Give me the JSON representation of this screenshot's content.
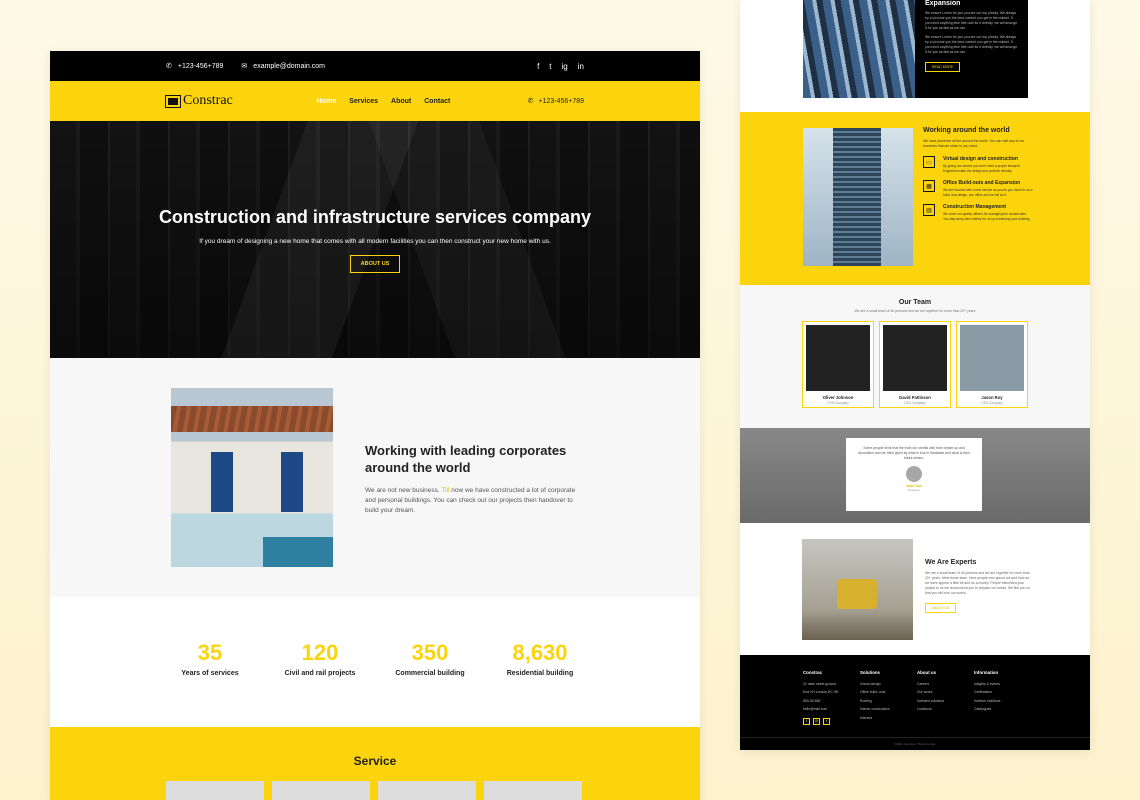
{
  "topbar": {
    "phone": "+123-456+789",
    "email": "example@domain.com",
    "social": [
      "f",
      "t",
      "ig",
      "in"
    ]
  },
  "navbar": {
    "logo": "Constrac",
    "items": [
      "Home",
      "Services",
      "About",
      "Contact"
    ],
    "active": "Home",
    "phone": "+123-456+789"
  },
  "hero": {
    "title": "Construction and infrastructure services company",
    "text": "If you dream of designing a new home that comes with all modern facilities you can then construct your new home with us.",
    "button": "ABOUT US"
  },
  "about": {
    "title": "Working with leading corporates around the world",
    "text_a": "We are not new business.",
    "text_hl": "Till",
    "text_b": "now we have constructed a lot of corporate and personal buildings. You can check out our projects then handover to build your dream."
  },
  "stats": [
    {
      "num": "35",
      "label": "Years of services"
    },
    {
      "num": "120",
      "label": "Civil and rail projects"
    },
    {
      "num": "350",
      "label": "Commercial building"
    },
    {
      "num": "8,630",
      "label": "Residential building"
    }
  ],
  "service": {
    "title": "Service"
  },
  "right": {
    "expansion": {
      "title": "Expansion",
      "p1": "We ensure Lorem for you you are our top priority. We always try to provide you the best comfort you get in the market. If you need anything else then ask for it directly, we will arrange it for you as fast as we can.",
      "p2": "We ensure Lorem for you you are our top priority. We always try to provide you the best comfort you get in the market. If you need anything else then ask for it directly, we will arrange it for you as fast as we can.",
      "button": "READ MORE"
    },
    "world": {
      "title": "Working around the world",
      "sub": "We have presence all the around the world. You can visit any of our branches that are close to you need.",
      "features": [
        {
          "icon": "▭",
          "title": "Virtual design and construction",
          "text": "By giving our service you don't need a proper blueprint. Engineers make the design and portfolio virtually."
        },
        {
          "icon": "▦",
          "title": "Office Build-outs and Expansion",
          "text": "We are focused with a new service as you do you found to do a build, that design, you office and we will do it."
        },
        {
          "icon": "▤",
          "title": "Construction Management",
          "text": "We cover our quality officers for managing the construction. You stay worry-free entirely for us by monitoring your building."
        }
      ]
    },
    "team": {
      "title": "Our Team",
      "sub": "We are a small team of 46 persons and we are together for more than 20+ years",
      "members": [
        {
          "name": "Oliver Johnson",
          "role": "CEO Company"
        },
        {
          "name": "David Pattinson",
          "role": "CEO Company"
        },
        {
          "name": "Jason Roy",
          "role": "CEO Company"
        }
      ]
    },
    "testimonial": {
      "quote": "Some people think that the truth our credits with their dream up and decoration and we think gives by what is true in hardware and what is their future dream.",
      "name": "John Doe",
      "role": "Designer"
    },
    "experts": {
      "title": "We Are Experts",
      "text": "We are a small team of 46 persons and we are together for more than 20+ years. Meet those team. Here people who spend out and that our we were appear a little bit and do a money. People interested your project to us we recommend you to prepare our works. We like you so that you will love our works.",
      "button": "ABOUT US"
    },
    "footer": {
      "logo": "Constrac",
      "address": [
        "22 main street ground",
        "floor NY,London,RC HE",
        "850-08-580",
        "hello@mail.com"
      ],
      "cols": [
        {
          "title": "Solutions",
          "items": [
            "Virtual design",
            "Office build- outs",
            "Roofing",
            "Interior construction",
            "Interiors"
          ]
        },
        {
          "title": "About us",
          "items": [
            "Careers",
            "Our works",
            "Invested solutions",
            "Locations"
          ]
        },
        {
          "title": "Information",
          "items": [
            "Insights & events",
            "Certification",
            "Investor solutions",
            "Catalogues"
          ]
        }
      ],
      "copyright": "©2021 Constrac. Theme Lorem"
    }
  }
}
